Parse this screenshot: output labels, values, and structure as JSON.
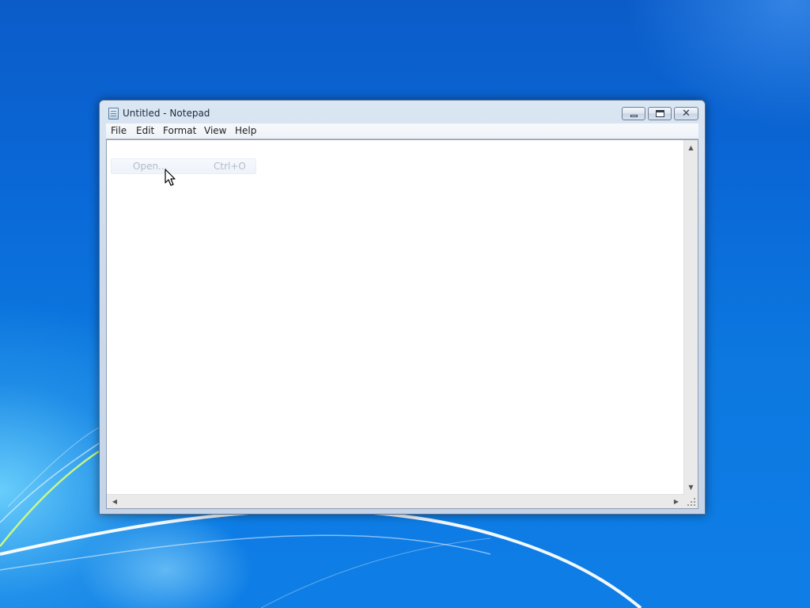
{
  "window": {
    "title": "Untitled - Notepad",
    "app_icon": "notepad-icon",
    "caption_buttons": {
      "minimize": "minimize-icon",
      "maximize": "maximize-icon",
      "close": "close-icon",
      "close_glyph": "✕"
    }
  },
  "menubar": {
    "items": [
      {
        "label": "File"
      },
      {
        "label": "Edit"
      },
      {
        "label": "Format"
      },
      {
        "label": "View"
      },
      {
        "label": "Help"
      }
    ]
  },
  "dropdown": {
    "label": "Open...",
    "shortcut": "Ctrl+O"
  },
  "scrollbars": {
    "up_glyph": "▲",
    "down_glyph": "▼",
    "left_glyph": "◀",
    "right_glyph": "▶"
  },
  "colors": {
    "desktop_blue": "#0c78e0",
    "titlebar": "#cddbec",
    "editor_bg": "#ffffff"
  }
}
